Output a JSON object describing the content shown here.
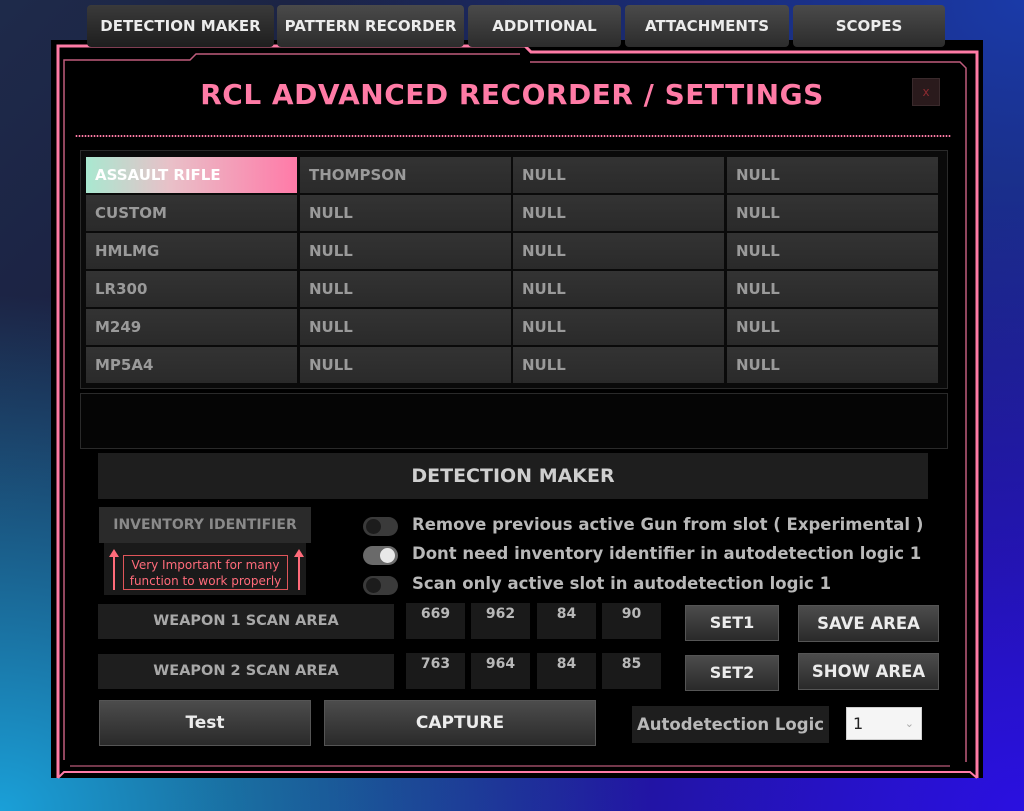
{
  "window": {
    "title": "RCL  ADVANCED RECORDER / SETTINGS",
    "close_label": "x",
    "accent_color": "#ff7ba6"
  },
  "weapons_grid": {
    "rows": [
      [
        "ASSAULT RIFLE",
        "THOMPSON",
        "NULL",
        "NULL"
      ],
      [
        "CUSTOM",
        "NULL",
        "NULL",
        "NULL"
      ],
      [
        "HMLMG",
        "NULL",
        "NULL",
        "NULL"
      ],
      [
        "LR300",
        "NULL",
        "NULL",
        "NULL"
      ],
      [
        "M249",
        "NULL",
        "NULL",
        "NULL"
      ],
      [
        "MP5A4",
        "NULL",
        "NULL",
        "NULL"
      ]
    ],
    "selected": "ASSAULT RIFLE"
  },
  "tabs": [
    {
      "label": "DETECTION MAKER",
      "active": true
    },
    {
      "label": "PATTERN RECORDER",
      "active": false
    },
    {
      "label": "ADDITIONAL",
      "active": false
    },
    {
      "label": "ATTACHMENTS",
      "active": false
    },
    {
      "label": "SCOPES",
      "active": false
    }
  ],
  "detection": {
    "header": "DETECTION MAKER",
    "inventory_identifier_label": "INVENTORY IDENTIFIER",
    "warning_line1": "Very Important for many",
    "warning_line2": "function to work properly",
    "options": [
      {
        "label": "Remove previous active Gun from slot ( Experimental )",
        "enabled": false
      },
      {
        "label": "Dont need inventory identifier in autodetection logic 1",
        "enabled": true
      },
      {
        "label": "Scan only active slot in autodetection logic 1",
        "enabled": false
      }
    ],
    "weapon1": {
      "label": "WEAPON 1 SCAN AREA",
      "values": [
        "669",
        "962",
        "84",
        "90"
      ]
    },
    "weapon2": {
      "label": "WEAPON 2 SCAN AREA",
      "values": [
        "763",
        "964",
        "84",
        "85"
      ]
    },
    "set1_label": "SET1",
    "set2_label": "SET2",
    "save_area_label": "SAVE AREA",
    "show_area_label": "SHOW AREA",
    "test_label": "Test",
    "capture_label": "CAPTURE",
    "autodetection_label": "Autodetection Logic",
    "autodetection_value": "1"
  }
}
